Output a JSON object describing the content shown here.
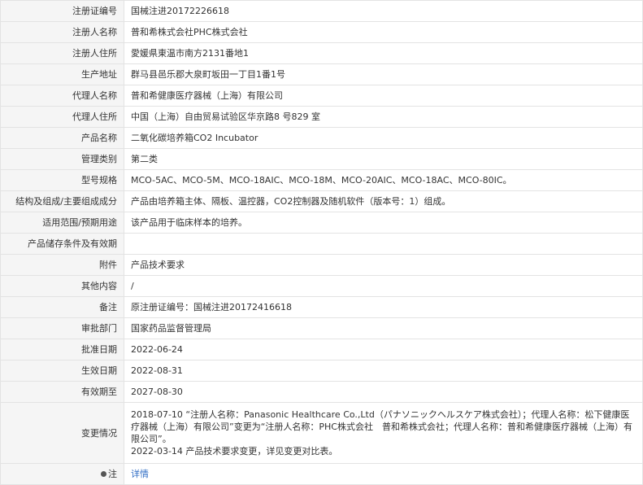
{
  "rows": [
    {
      "label": "注册证编号",
      "value": "国械注进20172226618"
    },
    {
      "label": "注册人名称",
      "value": "普和希株式会社PHC株式会社"
    },
    {
      "label": "注册人住所",
      "value": "愛媛県東温市南方2131番地1"
    },
    {
      "label": "生产地址",
      "value": "群马县邑乐郡大泉町坂田一丁目1番1号"
    },
    {
      "label": "代理人名称",
      "value": "普和希健康医疗器械（上海）有限公司"
    },
    {
      "label": "代理人住所",
      "value": "中国（上海）自由贸易试验区华京路8 号829 室"
    },
    {
      "label": "产品名称",
      "value": "二氧化碳培养箱CO2 Incubator"
    },
    {
      "label": "管理类别",
      "value": "第二类"
    },
    {
      "label": "型号规格",
      "value": "MCO-5AC、MCO-5M、MCO-18AIC、MCO-18M、MCO-20AIC、MCO-18AC、MCO-80IC。"
    },
    {
      "label": "结构及组成/主要组成成分",
      "value": "产品由培养箱主体、隔板、温控器，CO2控制器及随机软件（版本号：1）组成。"
    },
    {
      "label": "适用范围/预期用途",
      "value": "该产品用于临床样本的培养。"
    },
    {
      "label": "产品储存条件及有效期",
      "value": ""
    },
    {
      "label": "附件",
      "value": "产品技术要求"
    },
    {
      "label": "其他内容",
      "value": "/"
    },
    {
      "label": "备注",
      "value": "原注册证编号：国械注进20172416618"
    },
    {
      "label": "审批部门",
      "value": "国家药品监督管理局"
    },
    {
      "label": "批准日期",
      "value": "2022-06-24"
    },
    {
      "label": "生效日期",
      "value": "2022-08-31"
    },
    {
      "label": "有效期至",
      "value": "2027-08-30"
    }
  ],
  "change": {
    "label": "变更情况",
    "line1": "2018-07-10 “注册人名称：Panasonic Healthcare Co.,Ltd（パナソニックヘルスケア株式会社）；代理人名称：松下健康医疗器械（上海）有限公司”变更为“注册人名称：PHC株式会社　普和希株式会社；代理人名称：普和希健康医疗器械（上海）有限公司”。",
    "line2": "2022-03-14 产品技术要求变更，详见变更对比表。"
  },
  "note": {
    "label": "注",
    "icon": "location-pin-icon",
    "link": "详情"
  }
}
